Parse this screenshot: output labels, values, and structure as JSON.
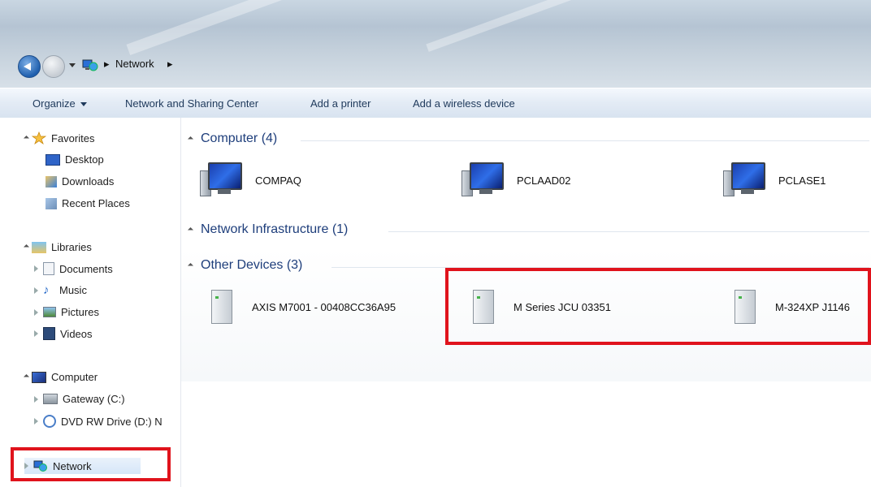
{
  "address_bar": {
    "crumbs": [
      "Network"
    ],
    "icon": "network-icon"
  },
  "toolbar": {
    "organize": "Organize",
    "network_sharing": "Network and Sharing Center",
    "add_printer": "Add a printer",
    "add_wireless": "Add a wireless device"
  },
  "nav": {
    "favorites": {
      "label": "Favorites",
      "items": [
        "Desktop",
        "Downloads",
        "Recent Places"
      ]
    },
    "libraries": {
      "label": "Libraries",
      "items": [
        "Documents",
        "Music",
        "Pictures",
        "Videos"
      ]
    },
    "computer": {
      "label": "Computer",
      "items": [
        "Gateway (C:)",
        "DVD RW Drive (D:) N"
      ]
    },
    "network": {
      "label": "Network"
    }
  },
  "groups": {
    "computer": {
      "title": "Computer (4)",
      "items": [
        "COMPAQ",
        "PCLAAD02",
        "PCLASE1"
      ]
    },
    "infrastructure": {
      "title": "Network Infrastructure (1)"
    },
    "other": {
      "title": "Other Devices (3)",
      "items": [
        "AXIS M7001 - 00408CC36A95",
        "M Series JCU 03351",
        "M-324XP J1146"
      ]
    }
  },
  "highlight_color": "#e0131c"
}
